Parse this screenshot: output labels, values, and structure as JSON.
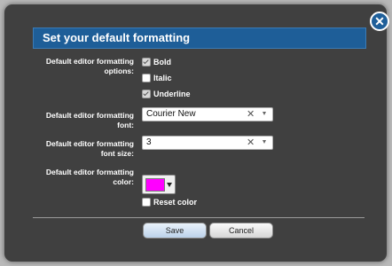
{
  "dialog": {
    "title": "Set your default formatting",
    "close_icon": "close-icon"
  },
  "formatting_options": {
    "label_line1": "Default editor formatting",
    "label_line2": "options:",
    "bold": {
      "label": "Bold",
      "checked": true
    },
    "italic": {
      "label": "Italic",
      "checked": false
    },
    "underline": {
      "label": "Underline",
      "checked": true
    }
  },
  "font": {
    "label_line1": "Default editor formatting",
    "label_line2": "font:",
    "value": "Courier New",
    "clear_symbol": "✕"
  },
  "font_size": {
    "label_line1": "Default editor formatting",
    "label_line2": "font size:",
    "value": "3",
    "clear_symbol": "✕"
  },
  "color": {
    "label_line1": "Default editor formatting",
    "label_line2": "color:",
    "swatch_color": "#ff00ff",
    "reset_label": "Reset color",
    "reset_checked": false
  },
  "buttons": {
    "save": "Save",
    "cancel": "Cancel"
  }
}
